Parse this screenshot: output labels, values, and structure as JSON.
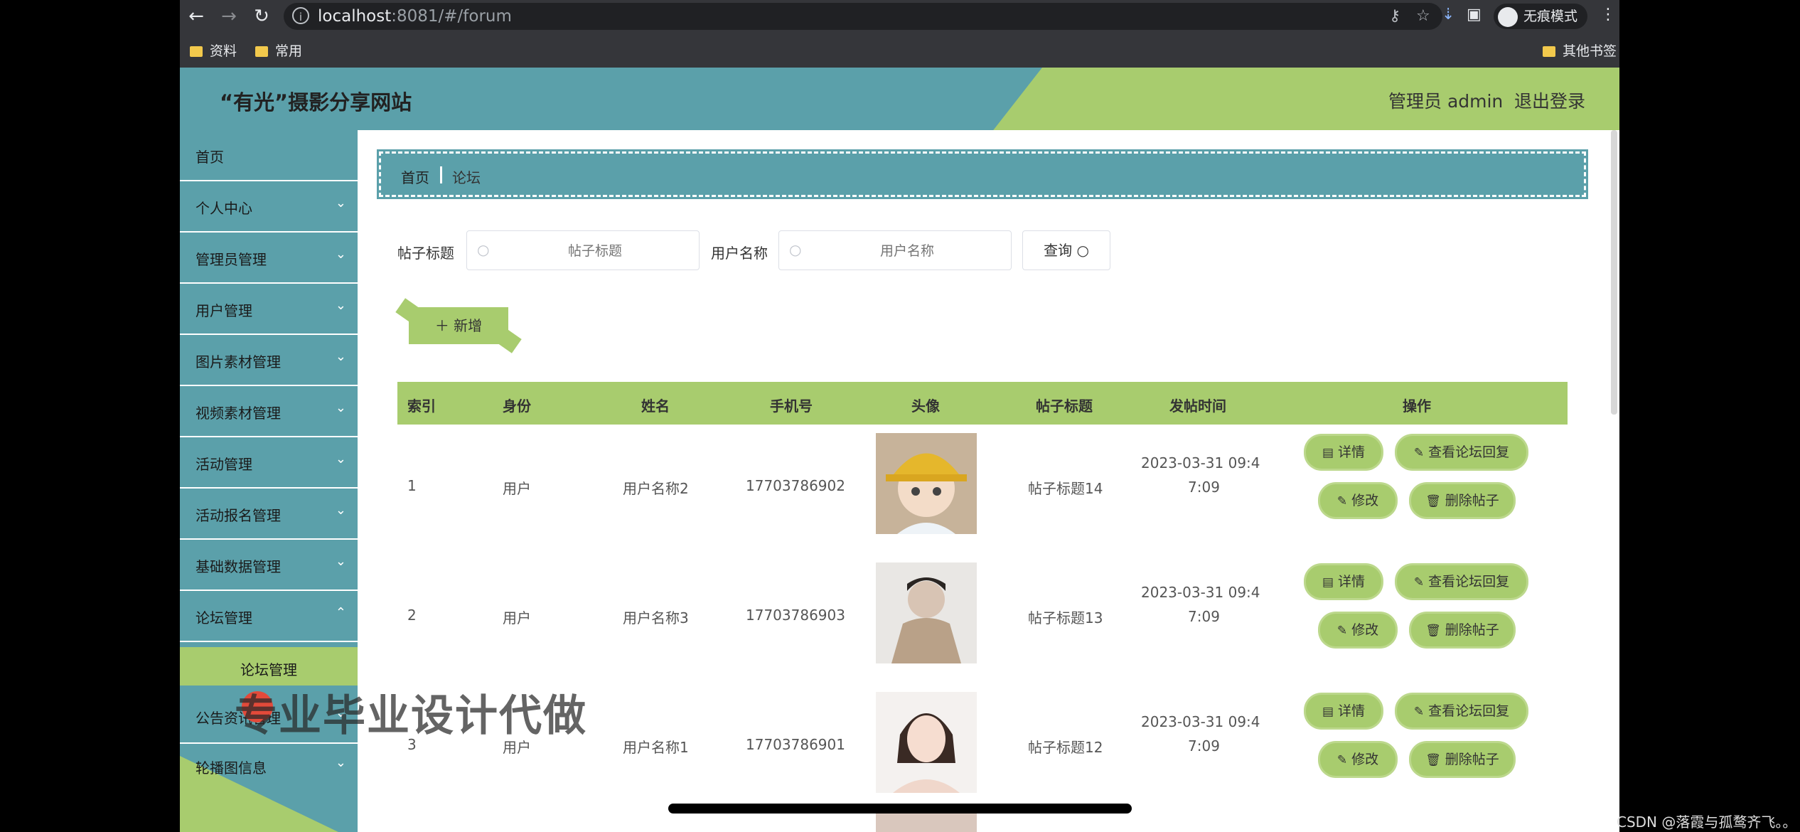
{
  "browser": {
    "url_host": "localhost",
    "url_rest": ":8081/#/forum",
    "incognito_label": "无痕模式",
    "bookmarks": [
      "资料",
      "常用"
    ],
    "other_bookmarks": "其他书签"
  },
  "header": {
    "title": "“有光”摄影分享网站",
    "user": "管理员 admin",
    "logout": "退出登录"
  },
  "sidebar": {
    "items": [
      {
        "label": "首页",
        "chevron": false
      },
      {
        "label": "个人中心",
        "chevron": true
      },
      {
        "label": "管理员管理",
        "chevron": true
      },
      {
        "label": "用户管理",
        "chevron": true
      },
      {
        "label": "图片素材管理",
        "chevron": true
      },
      {
        "label": "视频素材管理",
        "chevron": true
      },
      {
        "label": "活动管理",
        "chevron": true
      },
      {
        "label": "活动报名管理",
        "chevron": true
      },
      {
        "label": "基础数据管理",
        "chevron": true
      },
      {
        "label": "论坛管理",
        "chevron": true
      }
    ],
    "sub_item": "论坛管理",
    "items_after": [
      {
        "label": "公告资讯管理",
        "chevron": true
      },
      {
        "label": "轮播图信息",
        "chevron": true
      }
    ]
  },
  "breadcrumb": {
    "home": "首页",
    "current": "论坛"
  },
  "filters": {
    "title_label": "帖子标题",
    "title_placeholder": "帖子标题",
    "user_label": "用户名称",
    "user_placeholder": "用户名称",
    "query_button": "查询"
  },
  "add_button": "新增",
  "table": {
    "columns": [
      "索引",
      "身份",
      "姓名",
      "手机号",
      "头像",
      "帖子标题",
      "发帖时间",
      "操作"
    ],
    "rows": [
      {
        "index": "1",
        "role": "用户",
        "name": "用户名称2",
        "phone": "17703786902",
        "title": "帖子标题14",
        "time_line1": "2023-03-31 09:4",
        "time_line2": "7:09"
      },
      {
        "index": "2",
        "role": "用户",
        "name": "用户名称3",
        "phone": "17703786903",
        "title": "帖子标题13",
        "time_line1": "2023-03-31 09:4",
        "time_line2": "7:09"
      },
      {
        "index": "3",
        "role": "用户",
        "name": "用户名称1",
        "phone": "17703786901",
        "title": "帖子标题12",
        "time_line1": "2023-03-31 09:4",
        "time_line2": "7:09"
      }
    ],
    "actions": {
      "detail": "详情",
      "view_replies": "查看论坛回复",
      "edit": "修改",
      "delete": "删除帖子"
    }
  },
  "overlay": {
    "watermark": "专业毕业设计代做",
    "csdn": "CSDN @落霞与孤鹜齐飞。。"
  },
  "colors": {
    "teal": "#5ba0aa",
    "green": "#a8cc6e"
  }
}
